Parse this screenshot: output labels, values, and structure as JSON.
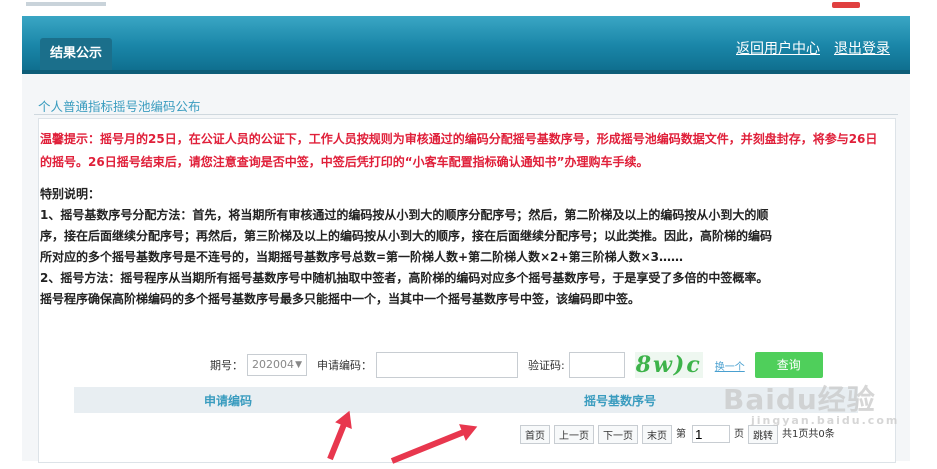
{
  "nav": {
    "tab_label": "结果公示",
    "links": [
      "返回用户中心",
      "退出登录"
    ]
  },
  "section": {
    "title": "个人普通指标摇号池编码公布"
  },
  "notice": "温馨提示：摇号月的25日，在公证人员的公证下，工作人员按规则为审核通过的编码分配摇号基数序号，形成摇号池编码数据文件，并刻盘封存，将参与26日的摇号。26日摇号结束后，请您注意查询是否中签，中签后凭打印的“小客车配置指标确认通知书”办理购车手续。",
  "special": {
    "heading": "特别说明：",
    "lines": [
      "1、摇号基数序号分配方法：首先，将当期所有审核通过的编码按从小到大的顺序分配序号；然后，第二阶梯及以上的编码按从小到大的顺",
      "序，接在后面继续分配序号；再然后，第三阶梯及以上的编码按从小到大的顺序，接在后面继续分配序号；以此类推。因此，高阶梯的编码",
      "所对应的多个摇号基数序号是不连号的，当期摇号基数序号总数=第一阶梯人数+第二阶梯人数×2+第三阶梯人数×3……",
      "2、摇号方法：摇号程序从当期所有摇号基数序号中随机抽取中签者，高阶梯的编码对应多个摇号基数序号，于是享受了多倍的中签概率。",
      "摇号程序确保高阶梯编码的多个摇号基数序号最多只能摇中一个，当其中一个摇号基数序号中签，该编码即中签。"
    ]
  },
  "form": {
    "period_label": "期号：",
    "period_value": "202004",
    "code_label": "申请编码：",
    "code_value": "",
    "captcha_label": "验证码:",
    "captcha_value": "",
    "captcha_text": "8w)c",
    "refresh_label": "换一个",
    "query_label": "查询"
  },
  "table": {
    "columns": [
      "申请编码",
      "摇号基数序号"
    ]
  },
  "pager": {
    "first": "首页",
    "prev": "上一页",
    "next": "下一页",
    "last": "末页",
    "page_prefix": "第",
    "page_value": "1",
    "page_suffix": "页",
    "go": "跳转",
    "total": "共1页共0条"
  },
  "watermark": {
    "text": "Baidu经验",
    "sub": "jingyan.baidu.com"
  }
}
